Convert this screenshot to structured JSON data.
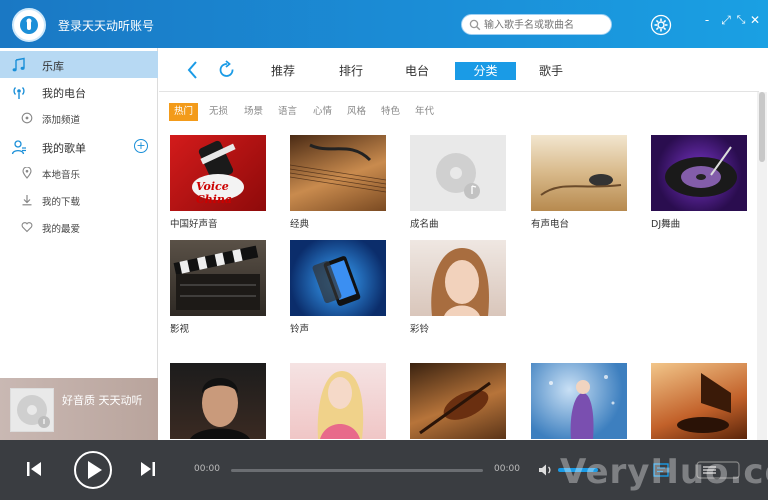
{
  "app": {
    "title": "登录天天动听账号"
  },
  "search": {
    "placeholder": "输入歌手名或歌曲名"
  },
  "window_controls": {
    "minimize": "-",
    "fullscreen": "⤢",
    "restore": "⤡",
    "close": "✕"
  },
  "sidebar": {
    "items": [
      {
        "label": "乐库",
        "icon": "music-note-icon",
        "active": true
      },
      {
        "label": "我的电台",
        "icon": "radio-antenna-icon"
      },
      {
        "label": "添加频道",
        "icon": "add-channel-icon"
      },
      {
        "label": "我的歌单",
        "icon": "user-icon"
      },
      {
        "label": "本地音乐",
        "icon": "location-pin-icon"
      },
      {
        "label": "我的下载",
        "icon": "download-icon"
      },
      {
        "label": "我的最爱",
        "icon": "heart-icon"
      }
    ]
  },
  "now_playing": {
    "text": "好音质 天天动听"
  },
  "nav": {
    "tabs": [
      {
        "label": "推荐"
      },
      {
        "label": "排行"
      },
      {
        "label": "电台"
      },
      {
        "label": "分类",
        "active": true
      },
      {
        "label": "歌手"
      }
    ]
  },
  "categories": [
    "热门",
    "无损",
    "场景",
    "语言",
    "心情",
    "风格",
    "特色",
    "年代"
  ],
  "tiles": [
    {
      "caption": "中国好声音",
      "thumb_text": "Voice China"
    },
    {
      "caption": "经典"
    },
    {
      "caption": "成名曲"
    },
    {
      "caption": "有声电台"
    },
    {
      "caption": "DJ舞曲"
    },
    {
      "caption": "影视"
    },
    {
      "caption": "铃声"
    },
    {
      "caption": "彩铃"
    },
    {
      "caption": ""
    },
    {
      "caption": ""
    },
    {
      "caption": ""
    },
    {
      "caption": ""
    },
    {
      "caption": ""
    }
  ],
  "player": {
    "current_time": "00:00",
    "total_time": "00:00",
    "progress": 0
  },
  "watermark": {
    "text": "VeryHuo.com"
  },
  "colors": {
    "accent": "#1a9be6",
    "hot_tag": "#f39b1a",
    "titlebar": "#1b8fd8",
    "player_bg": "#3a3d41"
  }
}
